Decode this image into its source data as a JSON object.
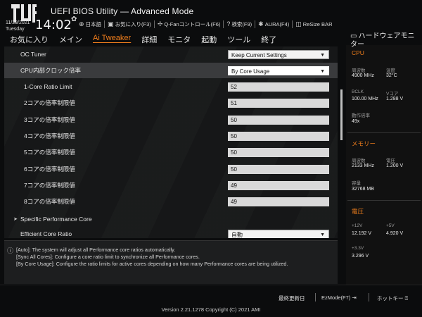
{
  "header": {
    "title": "UEFI BIOS Utility — Advanced Mode",
    "date": "11/23/2021",
    "weekday": "Tuesday",
    "time": "14:02",
    "shortcuts": [
      {
        "icon": "globe-icon",
        "glyph": "⊕",
        "label": "日本語"
      },
      {
        "icon": "bookmark-icon",
        "glyph": "▣",
        "label": "お気に入り(F3)"
      },
      {
        "icon": "fan-icon",
        "glyph": "✢",
        "label": "Q-Fanコントロール(F6)"
      },
      {
        "icon": "help-icon",
        "glyph": "?",
        "label": "検索(F9)"
      },
      {
        "icon": "aura-icon",
        "glyph": "✱",
        "label": "AURA(F4)"
      },
      {
        "icon": "resize-bar-icon",
        "glyph": "◫",
        "label": "ReSize BAR"
      }
    ]
  },
  "tabs": [
    {
      "label": "お気に入り",
      "active": false
    },
    {
      "label": "メイン",
      "active": false
    },
    {
      "label": "Ai Tweaker",
      "active": true
    },
    {
      "label": "詳細",
      "active": false
    },
    {
      "label": "モニタ",
      "active": false
    },
    {
      "label": "起動",
      "active": false
    },
    {
      "label": "ツール",
      "active": false
    },
    {
      "label": "終了",
      "active": false
    }
  ],
  "settings": [
    {
      "label": "OC Tuner",
      "value": "Keep Current Settings",
      "kind": "dropdown"
    },
    {
      "label": "CPU内部クロック倍率",
      "value": "By Core Usage",
      "kind": "dropdown",
      "highlight": true
    },
    {
      "label": "1-Core Ratio Limit",
      "value": "52",
      "kind": "field",
      "indent": true
    },
    {
      "label": "2コアの倍率制限値",
      "value": "51",
      "kind": "field",
      "indent": true
    },
    {
      "label": "3コアの倍率制限値",
      "value": "50",
      "kind": "field",
      "indent": true
    },
    {
      "label": "4コアの倍率制限値",
      "value": "50",
      "kind": "field",
      "indent": true
    },
    {
      "label": "5コアの倍率制限値",
      "value": "50",
      "kind": "field",
      "indent": true
    },
    {
      "label": "6コアの倍率制限値",
      "value": "50",
      "kind": "field",
      "indent": true
    },
    {
      "label": "7コアの倍率制限値",
      "value": "49",
      "kind": "field",
      "indent": true
    },
    {
      "label": "8コアの倍率制限値",
      "value": "49",
      "kind": "field",
      "indent": true
    },
    {
      "label": "Specific Performance Core",
      "value": "",
      "kind": "submenu"
    },
    {
      "label": "Efficient Core Ratio",
      "value": "自動",
      "kind": "dropdown"
    }
  ],
  "help": {
    "lines": [
      "[Auto]: The system will adjust all Performance core ratios automatically.",
      "[Sync All Cores]: Configure a core ratio limit to synchronize all Performance cores.",
      "[By Core Usage]: Configure the ratio limits for active cores depending on how many Performance cores are being utilized."
    ]
  },
  "hardware_monitor": {
    "title": "ハードウェアモニター",
    "sections": [
      {
        "name": "CPU",
        "items": [
          {
            "label": "周波数",
            "value": "4900 MHz"
          },
          {
            "label": "温度",
            "value": "32°C"
          },
          {
            "label": "BCLK",
            "value": "100.00 MHz"
          },
          {
            "label": "Vコア",
            "value": "1.288 V"
          },
          {
            "label": "動作倍率",
            "value": "49x"
          }
        ]
      },
      {
        "name": "メモリー",
        "items": [
          {
            "label": "周波数",
            "value": "2133 MHz"
          },
          {
            "label": "電圧",
            "value": "1.200 V"
          },
          {
            "label": "容量",
            "value": "32768 MB"
          }
        ]
      },
      {
        "name": "電圧",
        "items": [
          {
            "label": "+12V",
            "value": "12.192 V"
          },
          {
            "label": "+5V",
            "value": "4.920 V"
          },
          {
            "label": "+3.3V",
            "value": "3.296 V"
          }
        ]
      }
    ]
  },
  "footer": {
    "last_modified": "最終更新日",
    "ezmode": "EzMode(F7)",
    "hotkeys": "ホットキー",
    "version": "Version 2.21.1278 Copyright (C) 2021 AMI"
  }
}
